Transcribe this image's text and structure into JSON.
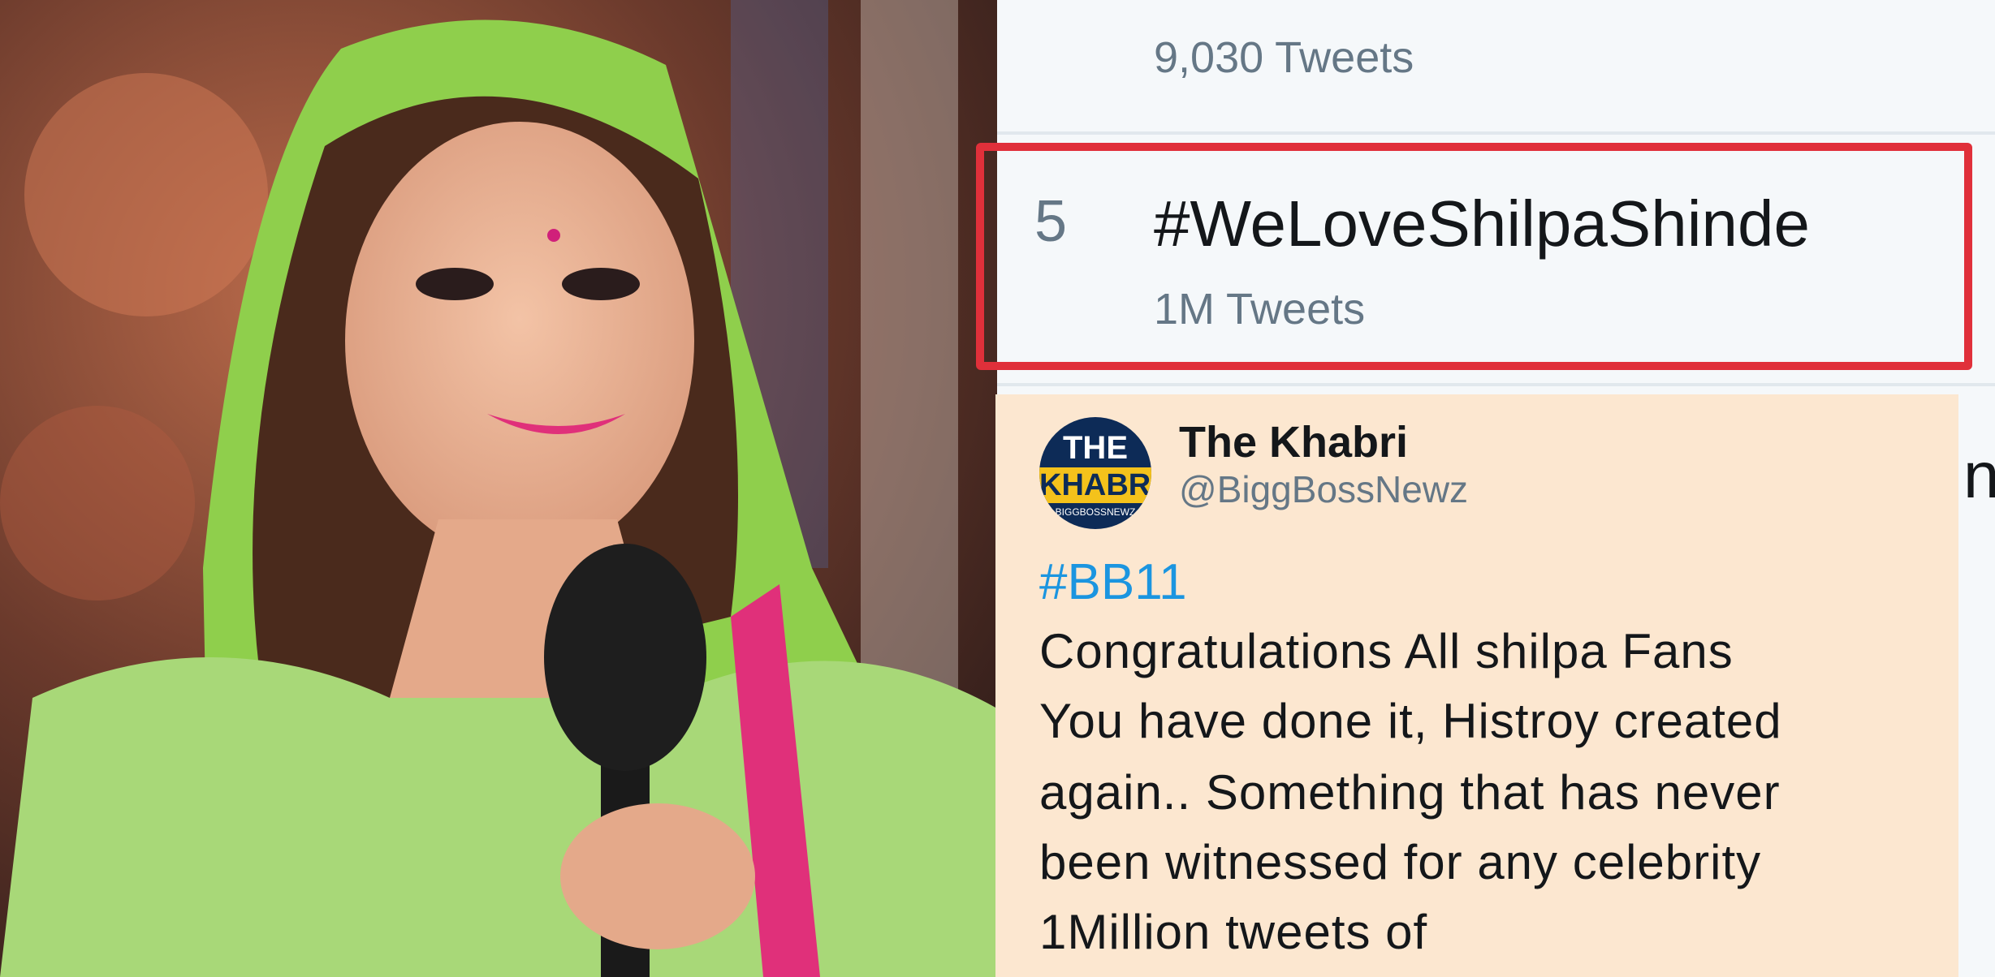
{
  "trends": {
    "previous": {
      "count": "9,030 Tweets"
    },
    "highlighted": {
      "rank": "5",
      "name": "#WeLoveShilpaShinde",
      "count": "1M Tweets"
    },
    "highlight_color": "#e0303a"
  },
  "tweet": {
    "display_name": "The Khabri",
    "handle": "@BiggBossNewz",
    "avatar": {
      "top_text": "THE",
      "bottom_text": "KHABRI",
      "small_text": "BIGGBOSSNEWZ"
    },
    "hashtag": "#BB11",
    "body_lines": [
      "Congratulations All shilpa Fans",
      "You have done it, Histroy created",
      "again.. Something that has never",
      "been witnessed for any celebrity",
      "1Million tweets of"
    ],
    "background_color": "#fce7d0",
    "hashtag_color": "#1b95e0"
  }
}
